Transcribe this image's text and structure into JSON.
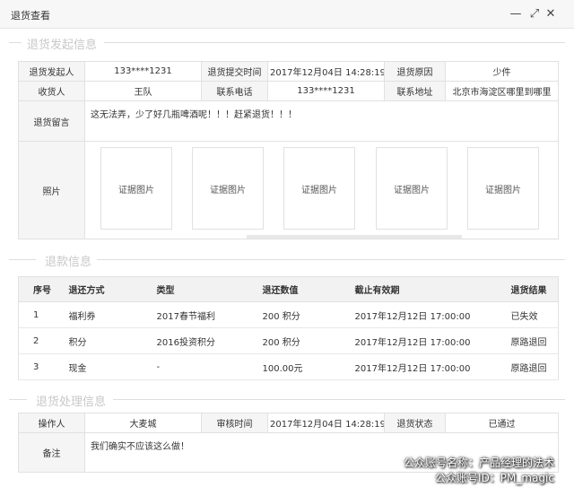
{
  "window": {
    "title": "退货查看",
    "minimize_glyph": "—",
    "maximize_glyph": "⤢",
    "close_glyph": "✕"
  },
  "sections": {
    "initiate": "退货发起信息",
    "refund": "退款信息",
    "process": "退货处理信息"
  },
  "initiate": {
    "initiator_label": "退货发起人",
    "initiator_value": "133****1231",
    "submit_time_label": "退货提交时间",
    "submit_time_value": "2017年12月04日 14:28:19",
    "reason_label": "退货原因",
    "reason_value": "少件",
    "receiver_label": "收货人",
    "receiver_value": "王队",
    "phone_label": "联系电话",
    "phone_value": "133****1231",
    "address_label": "联系地址",
    "address_value": "北京市海淀区哪里到哪里",
    "message_label": "退货留言",
    "message_value": "这无法弄，少了好几瓶啤酒呢！！！赶紧退货！！！",
    "photo_label": "照片",
    "photos": [
      "证据图片",
      "证据图片",
      "证据图片",
      "证据图片",
      "证据图片"
    ]
  },
  "refund": {
    "headers": [
      "序号",
      "退还方式",
      "类型",
      "退还数值",
      "截止有效期",
      "退货结果"
    ],
    "rows": [
      [
        "1",
        "福利券",
        "2017春节福利",
        "200 积分",
        "2017年12月12日 17:00:00",
        "已失效"
      ],
      [
        "2",
        "积分",
        "2016投资积分",
        "200 积分",
        "2017年12月12日 17:00:00",
        "原路退回"
      ],
      [
        "3",
        "现金",
        "-",
        "100.00元",
        "2017年12月12日 17:00:00",
        "原路退回"
      ]
    ]
  },
  "process": {
    "operator_label": "操作人",
    "operator_value": "大麦城",
    "review_time_label": "审核时间",
    "review_time_value": "2017年12月04日 14:28:19",
    "status_label": "退货状态",
    "status_value": "已通过",
    "remark_label": "备注",
    "remark_value": "我们确实不应该这么做！"
  },
  "watermark": {
    "line1": "公众账号名称：产品经理的法术",
    "line2": "公众账号ID：PM_magic"
  },
  "colors": {
    "status_ok": "#2aa52a",
    "section_title": "#c8c8c8"
  }
}
